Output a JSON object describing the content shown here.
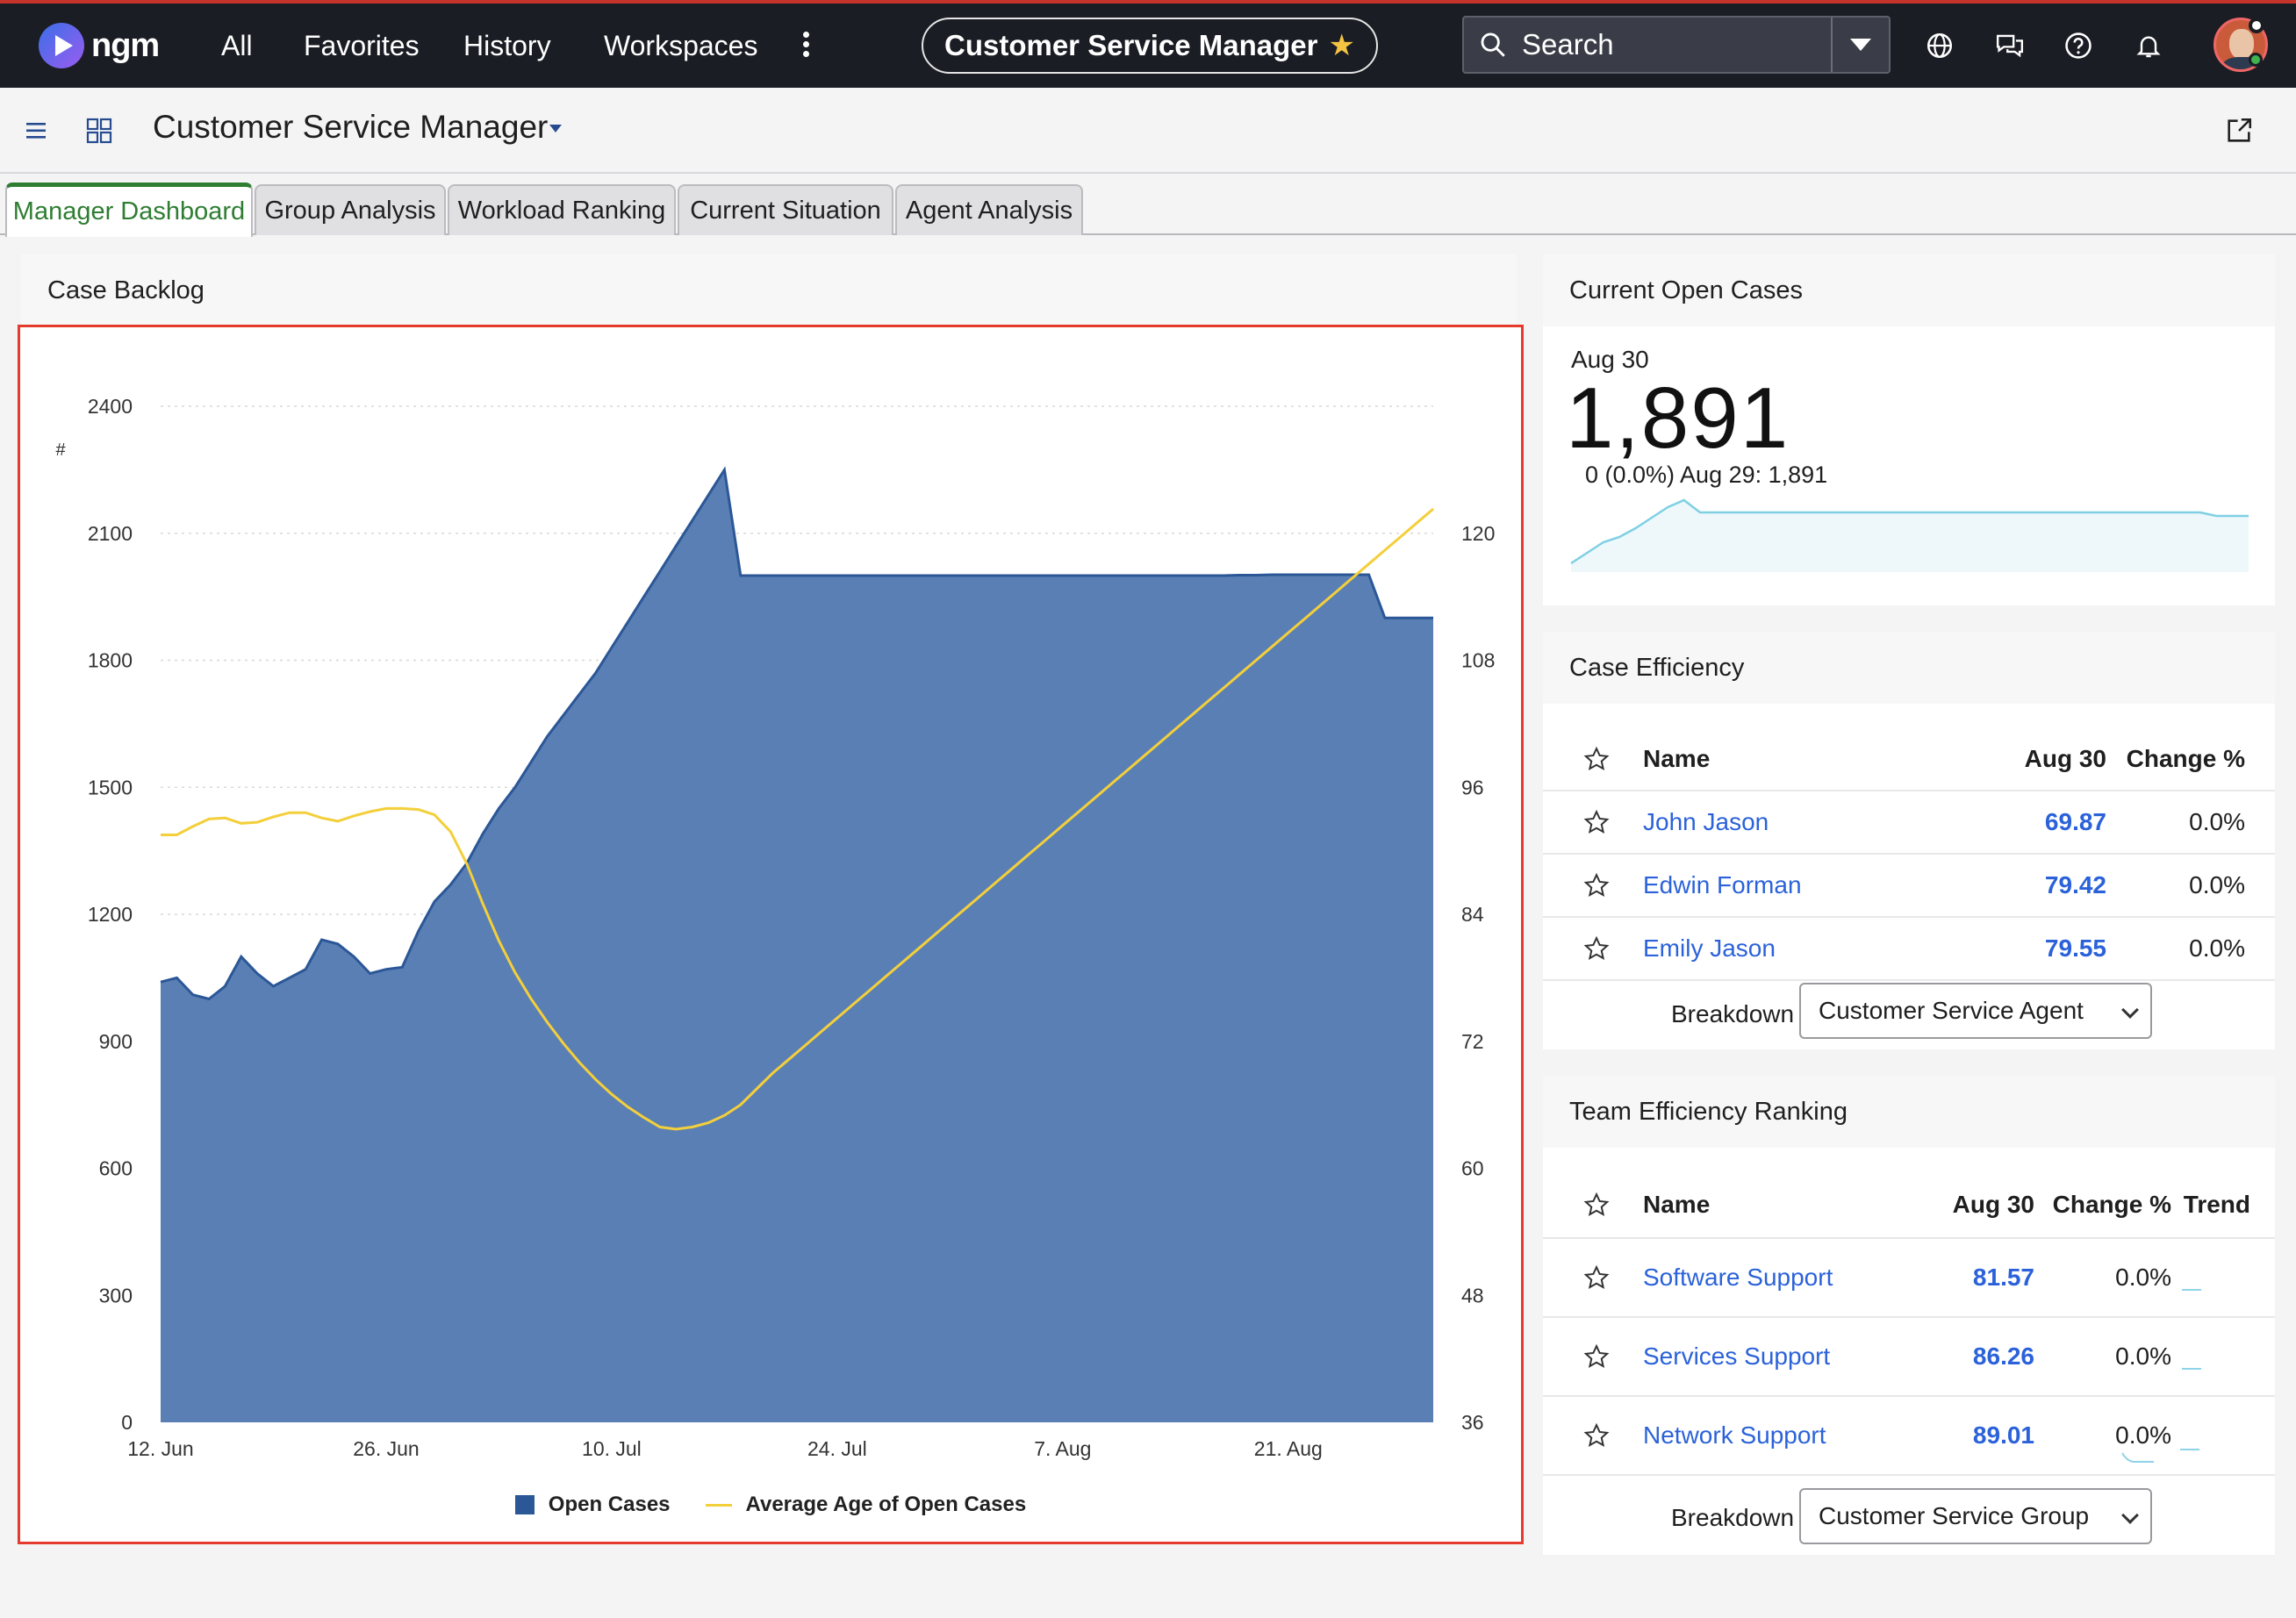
{
  "topbar": {
    "brand": "ngm",
    "nav": [
      "All",
      "Favorites",
      "History",
      "Workspaces"
    ],
    "context_title": "Customer Service Manager",
    "search_placeholder": "Search",
    "icons": [
      "globe-icon",
      "chat-icon",
      "help-icon",
      "bell-icon"
    ]
  },
  "subbar": {
    "title": "Customer Service Manager"
  },
  "tabs": [
    "Manager Dashboard",
    "Group Analysis",
    "Workload Ranking",
    "Current Situation",
    "Agent Analysis"
  ],
  "backlog": {
    "title": "Case Backlog",
    "y_unit": "#",
    "legend": [
      "Open Cases",
      "Average Age of Open Cases"
    ]
  },
  "open_cases": {
    "title": "Current Open Cases",
    "date": "Aug 30",
    "value": "1,891",
    "change": "0 (0.0%) Aug 29: 1,891",
    "sparkline": [
      1500,
      1560,
      1620,
      1650,
      1700,
      1760,
      1820,
      1860,
      1790,
      1790,
      1790,
      1790,
      1790,
      1790,
      1790,
      1790,
      1790,
      1790,
      1790,
      1790,
      1790,
      1790,
      1790,
      1790,
      1790,
      1790,
      1790,
      1790,
      1790,
      1790,
      1790,
      1790,
      1790,
      1790,
      1790,
      1790,
      1790,
      1790,
      1790,
      1790,
      1770,
      1770,
      1770
    ]
  },
  "case_efficiency": {
    "title": "Case Efficiency",
    "columns": [
      "Name",
      "Aug 30",
      "Change %"
    ],
    "rows": [
      {
        "name": "John Jason",
        "value": "69.87",
        "change": "0.0%"
      },
      {
        "name": "Edwin Forman",
        "value": "79.42",
        "change": "0.0%"
      },
      {
        "name": "Emily Jason",
        "value": "79.55",
        "change": "0.0%"
      }
    ],
    "breakdown_label": "Breakdown",
    "breakdown_value": "Customer Service Agent"
  },
  "team_ranking": {
    "title": "Team Efficiency Ranking",
    "columns": [
      "Name",
      "Aug 30",
      "Change %",
      "Trend"
    ],
    "rows": [
      {
        "name": "Software Support",
        "value": "81.57",
        "change": "0.0%"
      },
      {
        "name": "Services Support",
        "value": "86.26",
        "change": "0.0%"
      },
      {
        "name": "Network Support",
        "value": "89.01",
        "change": "0.0%"
      }
    ],
    "breakdown_label": "Breakdown",
    "breakdown_value": "Customer Service Group"
  },
  "chart_data": {
    "type": "area",
    "xlabel": "",
    "ylabel": "#",
    "x_ticks": [
      "12. Jun",
      "26. Jun",
      "10. Jul",
      "24. Jul",
      "7. Aug",
      "21. Aug"
    ],
    "ylim": [
      0,
      2400
    ],
    "y_ticks": [
      0,
      300,
      600,
      900,
      1200,
      1500,
      1800,
      2100,
      2400
    ],
    "y2lim": [
      36,
      132
    ],
    "y2_ticks": [
      36,
      48,
      60,
      72,
      84,
      96,
      108,
      120
    ],
    "grid": true,
    "legend_position": "bottom",
    "colors": {
      "open_cases": "#2b5797",
      "avg_age": "#f3cf3b"
    },
    "series": [
      {
        "name": "Open Cases",
        "axis": "left",
        "x_days": [
          0,
          1,
          2,
          3,
          4,
          5,
          6,
          7,
          8,
          9,
          10,
          11,
          12,
          13,
          14,
          15,
          16,
          17,
          18,
          19,
          20,
          21,
          22,
          23,
          24,
          25,
          26,
          27,
          28,
          29,
          30,
          31,
          32,
          33,
          34,
          35,
          36,
          37,
          38,
          39,
          40,
          41,
          42,
          43,
          44,
          45,
          46,
          47,
          48,
          49,
          50,
          51,
          52,
          53,
          54,
          55,
          56,
          57,
          58,
          59,
          60,
          61,
          62,
          63,
          64,
          65,
          66,
          67,
          68,
          69,
          70,
          71,
          72,
          73,
          74,
          75,
          76,
          77,
          78,
          79
        ],
        "values": [
          1040,
          1050,
          1010,
          1000,
          1030,
          1100,
          1060,
          1030,
          1050,
          1070,
          1140,
          1130,
          1100,
          1060,
          1070,
          1075,
          1160,
          1230,
          1270,
          1320,
          1390,
          1450,
          1500,
          1560,
          1620,
          1670,
          1720,
          1770,
          1830,
          1890,
          1950,
          2010,
          2070,
          2130,
          2190,
          2250,
          2000,
          2000,
          2000,
          2000,
          2000,
          2000,
          2000,
          2000,
          2000,
          2000,
          2000,
          2000,
          2000,
          2000,
          2000,
          2000,
          2000,
          2000,
          2000,
          2000,
          2000,
          2000,
          2000,
          2000,
          2000,
          2000,
          2000,
          2000,
          2000,
          2000,
          2000,
          2001,
          2001,
          2002,
          2002,
          2002,
          2002,
          2002,
          2002,
          2002,
          1900,
          1900,
          1900,
          1900
        ]
      },
      {
        "name": "Average Age of Open Cases",
        "axis": "right",
        "x_days": [
          0,
          1,
          2,
          3,
          4,
          5,
          6,
          7,
          8,
          9,
          10,
          11,
          12,
          13,
          14,
          15,
          16,
          17,
          18,
          19,
          20,
          21,
          22,
          23,
          24,
          25,
          26,
          27,
          28,
          29,
          30,
          31,
          32,
          33,
          34,
          35,
          36,
          37,
          38,
          39,
          40,
          41,
          42,
          43,
          44,
          45,
          46,
          47,
          48,
          49,
          50,
          51,
          52,
          53,
          54,
          55,
          56,
          57,
          58,
          59,
          60,
          61,
          62,
          63,
          64,
          65,
          66,
          67,
          68,
          69,
          70,
          71,
          72,
          73,
          74,
          75,
          76,
          77,
          78,
          79
        ],
        "values": [
          91.5,
          91.5,
          92.3,
          93.0,
          93.1,
          92.6,
          92.7,
          93.2,
          93.6,
          93.6,
          93.1,
          92.8,
          93.3,
          93.7,
          94.0,
          94.0,
          93.9,
          93.4,
          91.8,
          88.8,
          85.0,
          81.5,
          78.5,
          76.0,
          73.8,
          71.8,
          70.0,
          68.4,
          67.0,
          65.8,
          64.8,
          63.9,
          63.7,
          63.9,
          64.3,
          65.0,
          66.0,
          67.5,
          69.0,
          70.3,
          71.6,
          72.9,
          74.2,
          75.5,
          76.8,
          78.1,
          79.4,
          80.7,
          82.0,
          83.3,
          84.6,
          85.9,
          87.2,
          88.5,
          89.8,
          91.1,
          92.4,
          93.7,
          95.0,
          96.3,
          97.6,
          98.9,
          100.2,
          101.5,
          102.8,
          104.1,
          105.4,
          106.7,
          108.0,
          109.3,
          110.6,
          111.9,
          113.2,
          114.5,
          115.8,
          117.1,
          118.4,
          119.7,
          121.0,
          122.3
        ]
      }
    ]
  }
}
